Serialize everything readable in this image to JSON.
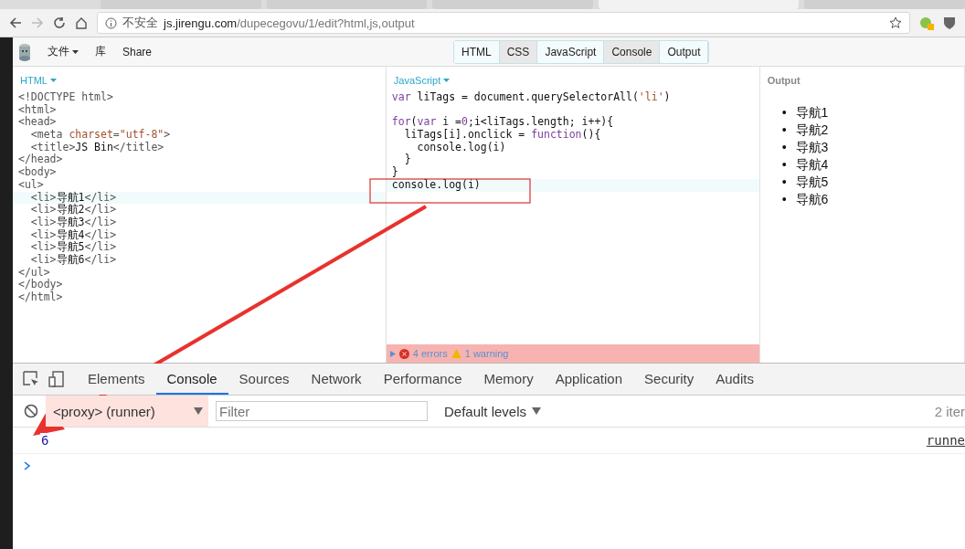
{
  "browser": {
    "tabs": [
      {
        "selected": false
      },
      {
        "selected": false
      },
      {
        "selected": false
      },
      {
        "selected": true
      },
      {
        "selected": false
      }
    ],
    "security": "不安全",
    "url_host": "js.jirengu.com",
    "url_path": "/dupecegovu/1/edit?html,js,output"
  },
  "toolbar": {
    "menus": [
      {
        "label": "文件",
        "dropdown": true
      },
      {
        "label": "库",
        "dropdown": false
      },
      {
        "label": "Share",
        "dropdown": false
      }
    ],
    "panel_toggles": [
      {
        "label": "HTML",
        "selected": true
      },
      {
        "label": "CSS",
        "selected": false
      },
      {
        "label": "JavaScript",
        "selected": true
      },
      {
        "label": "Console",
        "selected": false
      },
      {
        "label": "Output",
        "selected": true
      }
    ]
  },
  "html_panel": {
    "title": "HTML",
    "lines": [
      {
        "active": false,
        "segments": [
          {
            "kind": "tag",
            "text": "<!DOCTYPE html>"
          }
        ]
      },
      {
        "active": false,
        "segments": [
          {
            "kind": "tag",
            "text": "<html>"
          }
        ]
      },
      {
        "active": false,
        "segments": [
          {
            "kind": "tag",
            "text": "<head>"
          }
        ]
      },
      {
        "active": false,
        "segments": [
          {
            "kind": "tag",
            "text": "  <meta "
          },
          {
            "kind": "attr",
            "text": "charset"
          },
          {
            "kind": "tag",
            "text": "="
          },
          {
            "kind": "string",
            "text": "\"utf-8\""
          },
          {
            "kind": "tag",
            "text": ">"
          }
        ]
      },
      {
        "active": false,
        "segments": [
          {
            "kind": "tag",
            "text": "  <title>"
          },
          {
            "kind": "plain",
            "text": "JS Bin"
          },
          {
            "kind": "tag",
            "text": "</title>"
          }
        ]
      },
      {
        "active": false,
        "segments": [
          {
            "kind": "tag",
            "text": "</head>"
          }
        ]
      },
      {
        "active": false,
        "segments": [
          {
            "kind": "tag",
            "text": "<body>"
          }
        ]
      },
      {
        "active": false,
        "segments": [
          {
            "kind": "tag",
            "text": "<ul>"
          }
        ]
      },
      {
        "active": true,
        "segments": [
          {
            "kind": "tag",
            "text": "  <li>"
          },
          {
            "kind": "plain",
            "text": "导航1"
          },
          {
            "kind": "tag",
            "text": "</li>"
          }
        ]
      },
      {
        "active": false,
        "segments": [
          {
            "kind": "tag",
            "text": "  <li>"
          },
          {
            "kind": "plain",
            "text": "导航2"
          },
          {
            "kind": "tag",
            "text": "</li>"
          }
        ]
      },
      {
        "active": false,
        "segments": [
          {
            "kind": "tag",
            "text": "  <li>"
          },
          {
            "kind": "plain",
            "text": "导航3"
          },
          {
            "kind": "tag",
            "text": "</li>"
          }
        ]
      },
      {
        "active": false,
        "segments": [
          {
            "kind": "tag",
            "text": "  <li>"
          },
          {
            "kind": "plain",
            "text": "导航4"
          },
          {
            "kind": "tag",
            "text": "</li>"
          }
        ]
      },
      {
        "active": false,
        "segments": [
          {
            "kind": "tag",
            "text": "  <li>"
          },
          {
            "kind": "plain",
            "text": "导航5"
          },
          {
            "kind": "tag",
            "text": "</li>"
          }
        ]
      },
      {
        "active": false,
        "segments": [
          {
            "kind": "tag",
            "text": "  <li>"
          },
          {
            "kind": "plain",
            "text": "导航6"
          },
          {
            "kind": "tag",
            "text": "</li>"
          }
        ]
      },
      {
        "active": false,
        "segments": [
          {
            "kind": "tag",
            "text": "</ul>"
          }
        ]
      },
      {
        "active": false,
        "segments": [
          {
            "kind": "tag",
            "text": "</body>"
          }
        ]
      },
      {
        "active": false,
        "segments": [
          {
            "kind": "tag",
            "text": "</html>"
          }
        ]
      }
    ]
  },
  "js_panel": {
    "title": "JavaScript",
    "lines": [
      {
        "active": false,
        "segments": [
          {
            "kind": "keyword",
            "text": "var"
          },
          {
            "kind": "plain",
            "text": " liTags = document.querySelectorAll("
          },
          {
            "kind": "string",
            "text": "'li'"
          },
          {
            "kind": "plain",
            "text": ")"
          }
        ]
      },
      {
        "active": false
      },
      {
        "active": false,
        "segments": [
          {
            "kind": "keyword",
            "text": "for"
          },
          {
            "kind": "plain",
            "text": "("
          },
          {
            "kind": "keyword",
            "text": "var"
          },
          {
            "kind": "plain",
            "text": " i ="
          },
          {
            "kind": "number",
            "text": "0"
          },
          {
            "kind": "plain",
            "text": ";i<liTags.length; i++){"
          }
        ]
      },
      {
        "active": false,
        "segments": [
          {
            "kind": "plain",
            "text": "  liTags[i].onclick = "
          },
          {
            "kind": "keyword",
            "text": "function"
          },
          {
            "kind": "plain",
            "text": "(){"
          }
        ]
      },
      {
        "active": false,
        "segments": [
          {
            "kind": "plain",
            "text": "    console.log(i)"
          }
        ]
      },
      {
        "active": false,
        "segments": [
          {
            "kind": "plain",
            "text": "  }"
          }
        ]
      },
      {
        "active": false,
        "segments": [
          {
            "kind": "plain",
            "text": "}"
          }
        ]
      },
      {
        "active": true,
        "segments": [
          {
            "kind": "plain",
            "text": "console.log(i)"
          }
        ]
      }
    ],
    "status": {
      "errors": "4 errors",
      "warnings": "1 warning"
    }
  },
  "output_panel": {
    "title": "Output",
    "bullet": "•",
    "items": [
      "导航1",
      "导航2",
      "导航3",
      "导航4",
      "导航5",
      "导航6"
    ]
  },
  "devtools": {
    "tabs": [
      {
        "label": "Elements",
        "selected": false
      },
      {
        "label": "Console",
        "selected": true
      },
      {
        "label": "Sources",
        "selected": false
      },
      {
        "label": "Network",
        "selected": false
      },
      {
        "label": "Performance",
        "selected": false
      },
      {
        "label": "Memory",
        "selected": false
      },
      {
        "label": "Application",
        "selected": false
      },
      {
        "label": "Security",
        "selected": false
      },
      {
        "label": "Audits",
        "selected": false
      }
    ],
    "context": "<proxy> (runner)",
    "filter_placeholder": "Filter",
    "levels": "Default levels",
    "item_count": "2 iter",
    "messages": [
      {
        "value": "6",
        "source": "runne"
      }
    ]
  }
}
